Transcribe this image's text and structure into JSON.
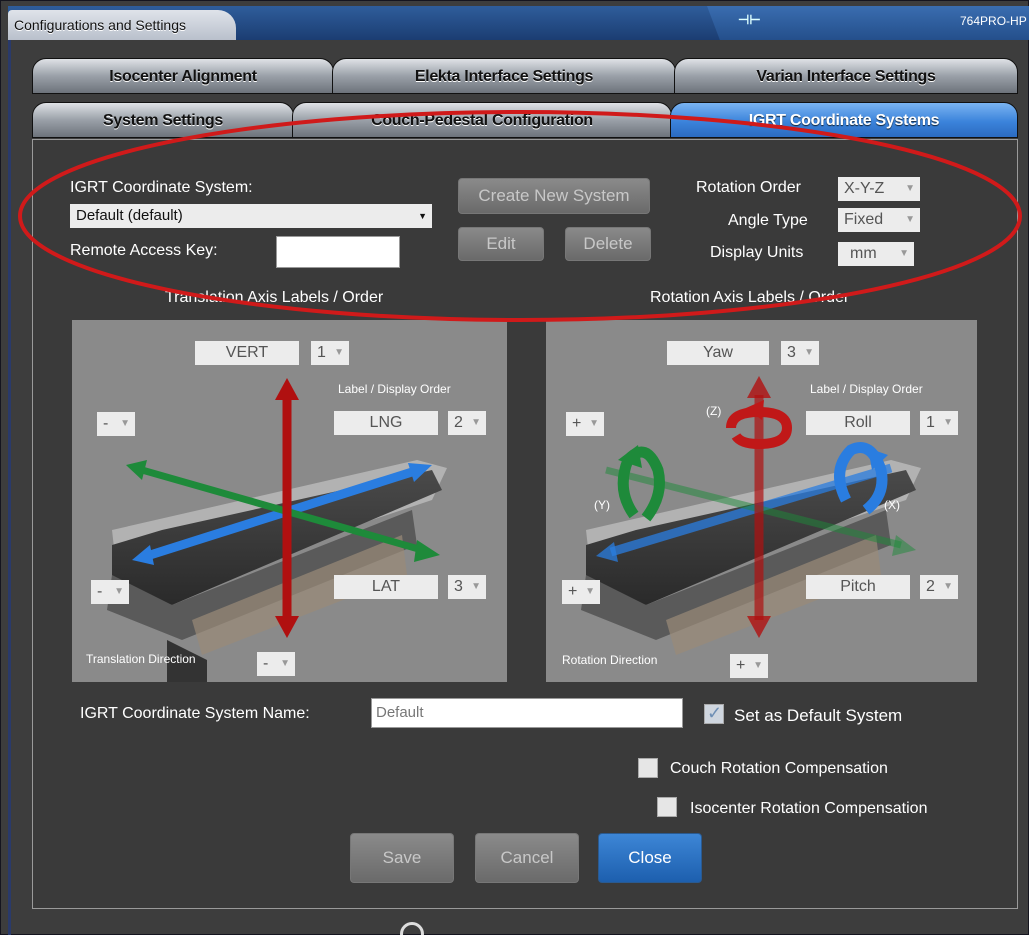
{
  "window": {
    "title": "Configurations and Settings",
    "machine": "764PRO-HP",
    "icon": "connection-icon"
  },
  "tabs_row1": [
    "Isocenter Alignment",
    "Elekta Interface Settings",
    "Varian Interface Settings"
  ],
  "tabs_row2": [
    "System Settings",
    "Couch-Pedestal Configuration",
    "IGRT Coordinate Systems"
  ],
  "form": {
    "system_label": "IGRT Coordinate System:",
    "system_value": "Default (default)",
    "remote_key_label": "Remote Access Key:",
    "remote_key_value": "",
    "create_btn": "Create New System",
    "edit_btn": "Edit",
    "delete_btn": "Delete",
    "rotation_order_label": "Rotation Order",
    "rotation_order_value": "X-Y-Z",
    "angle_type_label": "Angle Type",
    "angle_type_value": "Fixed",
    "display_units_label": "Display Units",
    "display_units_value": "mm"
  },
  "translation": {
    "header": "Translation Axis Labels / Order",
    "order_hint": "Label / Display Order",
    "direction_label": "Translation Direction",
    "vert_label": "VERT",
    "vert_order": "1",
    "lng_label": "LNG",
    "lng_order": "2",
    "lat_label": "LAT",
    "lat_order": "3",
    "left_top_sign": "-",
    "left_bottom_sign": "-",
    "direction_sign": "-"
  },
  "rotation": {
    "header": "Rotation Axis Labels / Order",
    "order_hint": "Label / Display Order",
    "direction_label": "Rotation Direction",
    "yaw_label": "Yaw",
    "yaw_order": "3",
    "roll_label": "Roll",
    "roll_order": "1",
    "pitch_label": "Pitch",
    "pitch_order": "2",
    "z_axis": "(Z)",
    "y_axis": "(Y)",
    "x_axis": "(X)",
    "left_top_sign": "+",
    "left_bottom_sign": "+",
    "direction_sign": "+"
  },
  "name_label": "IGRT Coordinate System Name:",
  "name_value": "Default",
  "set_default_label": "Set as Default System",
  "couch_comp_label": "Couch Rotation Compensation",
  "iso_comp_label": "Isocenter Rotation Compensation",
  "save_btn": "Save",
  "cancel_btn": "Cancel",
  "close_btn": "Close",
  "colors": {
    "active_tab": "#3b83db",
    "highlight_ellipse": "#d01a1a",
    "vert_arrow": "#b01010",
    "lng_arrow": "#2a7de0",
    "lat_arrow": "#1e8a3a"
  }
}
